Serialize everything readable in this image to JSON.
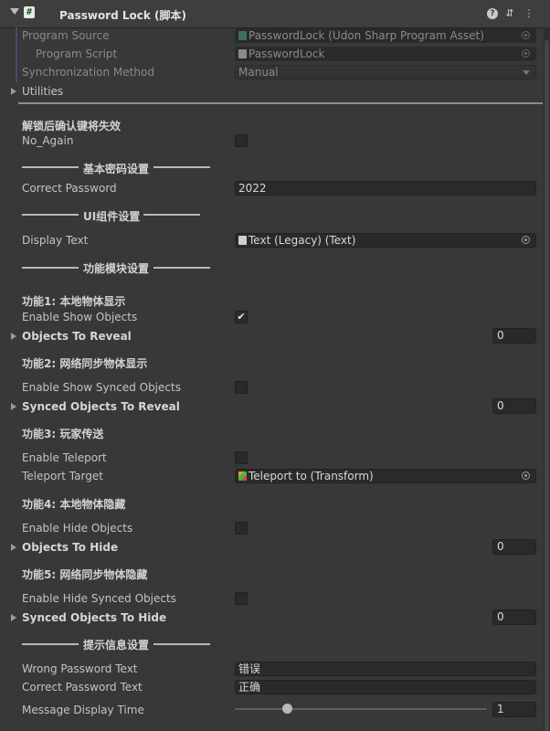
{
  "header": {
    "title": "Password Lock  (脚本)",
    "script_icon": "#",
    "icons": [
      "help-icon",
      "presets-icon",
      "kebab-menu-icon"
    ]
  },
  "script_fields": {
    "program_source_label": "Program Source",
    "program_source_value": "PasswordLock (Udon Sharp Program Asset)",
    "program_script_label": "Program Script",
    "program_script_value": "PasswordLock",
    "sync_label": "Synchronization Method",
    "sync_value": "Manual",
    "utilities_label": "Utilities"
  },
  "no_again": {
    "header": "解锁后确认键将失效",
    "label": "No_Again",
    "checked": false
  },
  "sections": {
    "basic": "基本密码设置",
    "ui": "UI组件设置",
    "modules": "功能模块设置",
    "messages": "提示信息设置"
  },
  "basic": {
    "correct_password_label": "Correct Password",
    "correct_password_value": "2022"
  },
  "ui": {
    "display_text_label": "Display Text",
    "display_text_value": "Text (Legacy) (Text)"
  },
  "features": {
    "f1_header": "功能1: 本地物体显示",
    "f1_enable_label": "Enable Show Objects",
    "f1_enabled": true,
    "f1_check_glyph": "✔",
    "f1_list_label": "Objects To Reveal",
    "f1_list_size": "0",
    "f2_header": "功能2: 网络同步物体显示",
    "f2_enable_label": "Enable Show Synced Objects",
    "f2_enabled": false,
    "f2_list_label": "Synced Objects To Reveal",
    "f2_list_size": "0",
    "f3_header": "功能3: 玩家传送",
    "f3_enable_label": "Enable Teleport",
    "f3_enabled": false,
    "f3_target_label": "Teleport Target",
    "f3_target_value": "Teleport to (Transform)",
    "f4_header": "功能4: 本地物体隐藏",
    "f4_enable_label": "Enable Hide Objects",
    "f4_enabled": false,
    "f4_list_label": "Objects To Hide",
    "f4_list_size": "0",
    "f5_header": "功能5: 网络同步物体隐藏",
    "f5_enable_label": "Enable Hide Synced Objects",
    "f5_enabled": false,
    "f5_list_label": "Synced Objects To Hide",
    "f5_list_size": "0"
  },
  "messages": {
    "wrong_label": "Wrong Password Text",
    "wrong_value": "错误",
    "correct_label": "Correct Password Text",
    "correct_value": "正确",
    "time_label": "Message Display Time",
    "time_value": "1",
    "time_fraction": 0.21
  },
  "colors": {
    "background": "#383838",
    "header": "#3e3e3e",
    "field": "#2a2a2a",
    "text": "#c4c4c4"
  }
}
